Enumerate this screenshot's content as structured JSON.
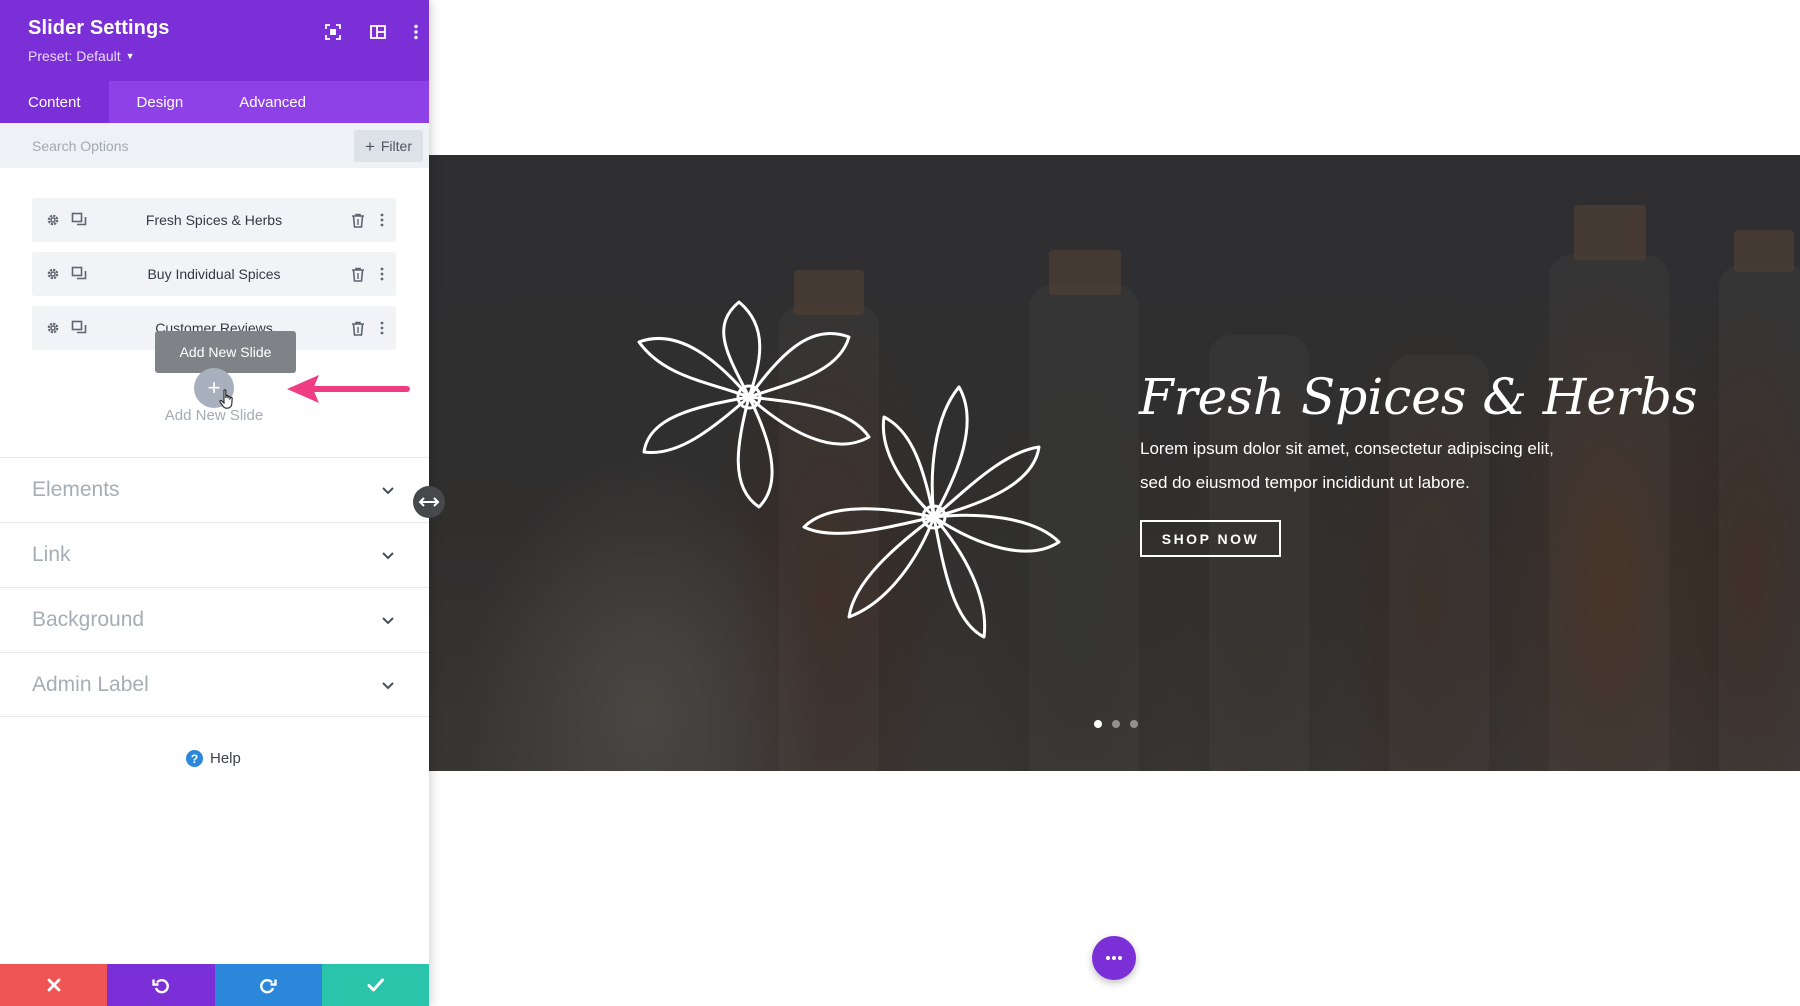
{
  "panel": {
    "title": "Slider Settings",
    "preset_label": "Preset: Default",
    "header_icons": [
      "fullscreen-icon",
      "layout-icon",
      "more-vertical-icon"
    ],
    "accent_color": "#7b2fd6",
    "tabs": [
      {
        "label": "Content",
        "active": true
      },
      {
        "label": "Design",
        "active": false
      },
      {
        "label": "Advanced",
        "active": false
      }
    ],
    "search": {
      "placeholder": "Search Options",
      "value": ""
    },
    "filter_label": "Filter",
    "slides": [
      {
        "label": "Fresh Spices & Herbs"
      },
      {
        "label": "Buy Individual Spices"
      },
      {
        "label": "Customer Reviews"
      }
    ],
    "add_slide_tooltip": "Add New Slide",
    "add_slide_label": "Add New Slide",
    "sections": [
      {
        "label": "Elements"
      },
      {
        "label": "Link"
      },
      {
        "label": "Background"
      },
      {
        "label": "Admin Label"
      }
    ],
    "help_label": "Help",
    "bottom_bar": [
      {
        "icon": "close-icon",
        "color": "#ef5555"
      },
      {
        "icon": "undo-icon",
        "color": "#7b2fd6"
      },
      {
        "icon": "redo-icon",
        "color": "#2b87da"
      },
      {
        "icon": "check-icon",
        "color": "#29c4a9"
      }
    ]
  },
  "slide_preview": {
    "heading": "Fresh Spices & Herbs",
    "body_line1": "Lorem ipsum dolor sit amet, consectetur adipiscing elit,",
    "body_line2": "sed do eiusmod tempor incididunt ut labore.",
    "button_label": "SHOP NOW",
    "dot_count": 3,
    "active_dot": 1
  },
  "fab_icon": "more-horizontal-icon"
}
